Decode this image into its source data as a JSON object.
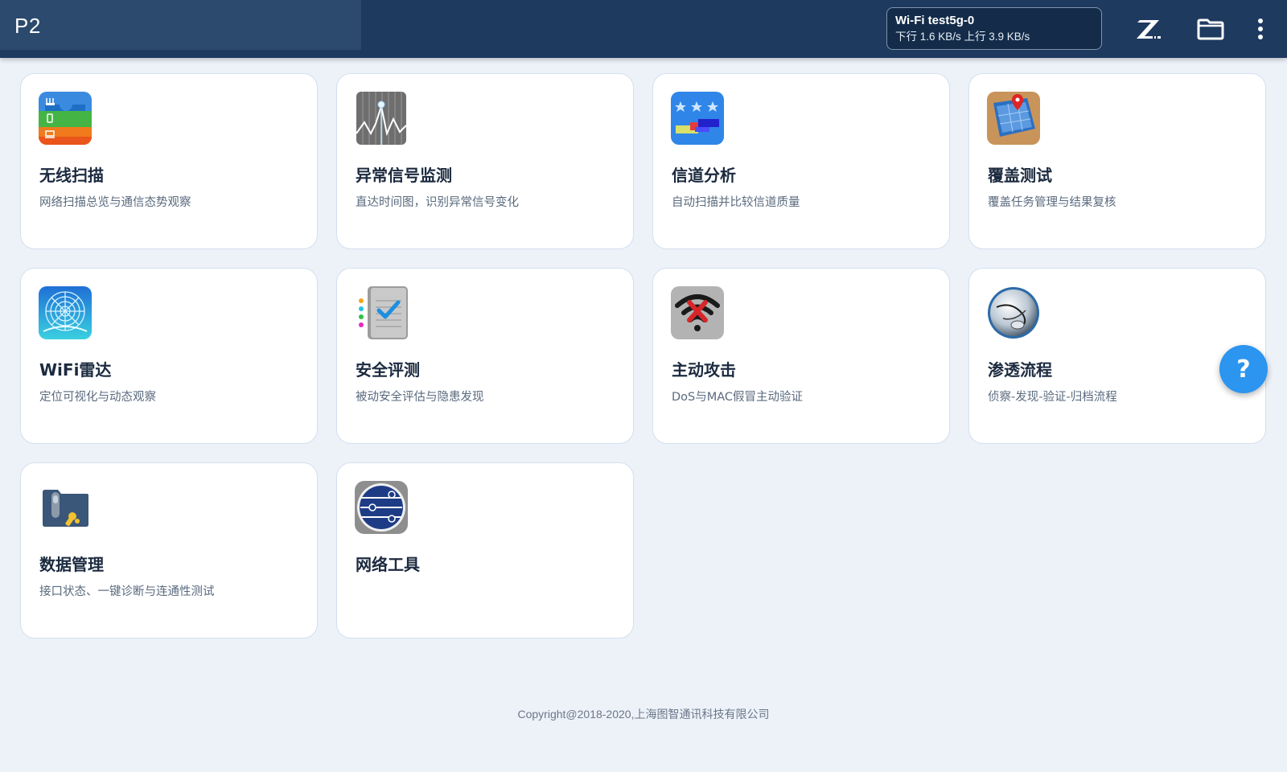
{
  "header": {
    "app_title": "P2",
    "wifi": {
      "ssid": "Wi-Fi test5g-0",
      "speed": "下行 1.6 KB/s 上行 3.9 KB/s"
    },
    "icons": [
      "z-logo-icon",
      "folder-icon",
      "more-vert-icon"
    ]
  },
  "cards": [
    {
      "title": "无线扫描",
      "desc": "网络扫描总览与通信态势观察",
      "icon": "wireless-scan-icon"
    },
    {
      "title": "异常信号监测",
      "desc": "直达时间图，识别异常信号变化",
      "icon": "signal-monitor-icon"
    },
    {
      "title": "信道分析",
      "desc": "自动扫描并比较信道质量",
      "icon": "channel-analysis-icon"
    },
    {
      "title": "覆盖测试",
      "desc": "覆盖任务管理与结果复核",
      "icon": "coverage-map-icon"
    },
    {
      "title": "WiFi雷达",
      "desc": "定位可视化与动态观察",
      "icon": "radar-icon"
    },
    {
      "title": "安全评测",
      "desc": "被动安全评估与隐患发现",
      "icon": "security-checklist-icon"
    },
    {
      "title": "主动攻击",
      "desc": "DoS与MAC假冒主动验证",
      "icon": "wifi-attack-icon"
    },
    {
      "title": "渗透流程",
      "desc": "侦察-发现-验证-归档流程",
      "icon": "penetration-icon"
    },
    {
      "title": "数据管理",
      "desc": "接口状态、一键诊断与连通性测试",
      "icon": "data-folder-icon"
    },
    {
      "title": "网络工具",
      "desc": "",
      "icon": "network-tools-icon"
    }
  ],
  "help_fab": {
    "label": "?",
    "icon": "help-icon"
  },
  "footer": {
    "copyright": "Copyright@2018-2020,上海图智通讯科技有限公司"
  },
  "colors": {
    "header_bg": "#1e3a5f",
    "page_bg": "#edf2f9",
    "accent": "#2b95f0"
  }
}
